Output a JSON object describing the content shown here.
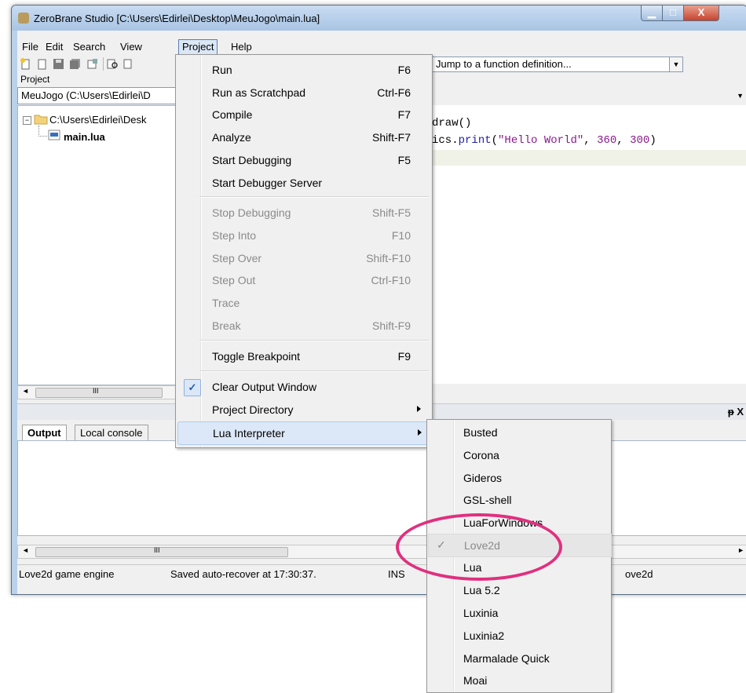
{
  "window": {
    "title": "ZeroBrane Studio [C:\\Users\\Edirlei\\Desktop\\MeuJogo\\main.lua]",
    "controls": {
      "minimize": "▁",
      "maximize": "□",
      "close": "X"
    }
  },
  "menubar": {
    "items": [
      "File",
      "Edit",
      "Search",
      "View",
      "Project",
      "Help"
    ]
  },
  "toolbar": {
    "icons": [
      "new-file-icon",
      "open-file-icon",
      "save-icon",
      "save-all-icon",
      "project-directory-icon",
      "find-icon",
      "replace-icon"
    ],
    "function_combo": "Jump to a function definition..."
  },
  "project_panel": {
    "label": "Project",
    "combo": "MeuJogo (C:\\Users\\Edirlei\\D",
    "tree_root": "C:\\Users\\Edirlei\\Desk",
    "tree_file": "main.lua",
    "scroll_glyph": "III"
  },
  "editor": {
    "line1": "draw()",
    "line2_prefix": "ics.",
    "line2_fn": "print",
    "line2_open": "(",
    "line2_string": "\"Hello World\"",
    "line2_comma1": ", ",
    "line2_num1": "360",
    "line2_comma2": ", ",
    "line2_num2": "300",
    "line2_close": ")"
  },
  "output": {
    "panel_controls": "ᵽ X",
    "tabs": [
      "Output",
      "Local console"
    ],
    "scroll_glyph": "III"
  },
  "statusbar": {
    "engine": "Love2d game engine",
    "autosave": "Saved auto-recover at 17:30:37.",
    "mode": "INS",
    "interpreter": "ove2d"
  },
  "project_menu": {
    "items": [
      {
        "label": "Run",
        "shortcut": "F6",
        "enabled": true
      },
      {
        "label": "Run as Scratchpad",
        "shortcut": "Ctrl-F6",
        "enabled": true
      },
      {
        "label": "Compile",
        "shortcut": "F7",
        "enabled": true
      },
      {
        "label": "Analyze",
        "shortcut": "Shift-F7",
        "enabled": true
      },
      {
        "label": "Start Debugging",
        "shortcut": "F5",
        "enabled": true
      },
      {
        "label": "Start Debugger Server",
        "shortcut": "",
        "enabled": true
      },
      {
        "label": "Stop Debugging",
        "shortcut": "Shift-F5",
        "enabled": false
      },
      {
        "label": "Step Into",
        "shortcut": "F10",
        "enabled": false
      },
      {
        "label": "Step Over",
        "shortcut": "Shift-F10",
        "enabled": false
      },
      {
        "label": "Step Out",
        "shortcut": "Ctrl-F10",
        "enabled": false
      },
      {
        "label": "Trace",
        "shortcut": "",
        "enabled": false
      },
      {
        "label": "Break",
        "shortcut": "Shift-F9",
        "enabled": false
      },
      {
        "label": "Toggle Breakpoint",
        "shortcut": "F9",
        "enabled": true
      },
      {
        "label": "Clear Output Window",
        "shortcut": "",
        "enabled": true,
        "checked": true
      },
      {
        "label": "Project Directory",
        "shortcut": "",
        "enabled": true,
        "submenu": true
      },
      {
        "label": "Lua Interpreter",
        "shortcut": "",
        "enabled": true,
        "submenu": true,
        "highlighted": true
      }
    ],
    "check_glyph": "✓"
  },
  "interpreter_menu": {
    "items": [
      "Busted",
      "Corona",
      "Gideros",
      "GSL-shell",
      "LuaForWindows",
      "Love2d",
      "Lua",
      "Lua 5.2",
      "Luxinia",
      "Luxinia2",
      "Marmalade Quick",
      "Moai"
    ],
    "selected": "Love2d",
    "check_glyph": "✓"
  },
  "annotation": {
    "color": "#e0307f"
  }
}
